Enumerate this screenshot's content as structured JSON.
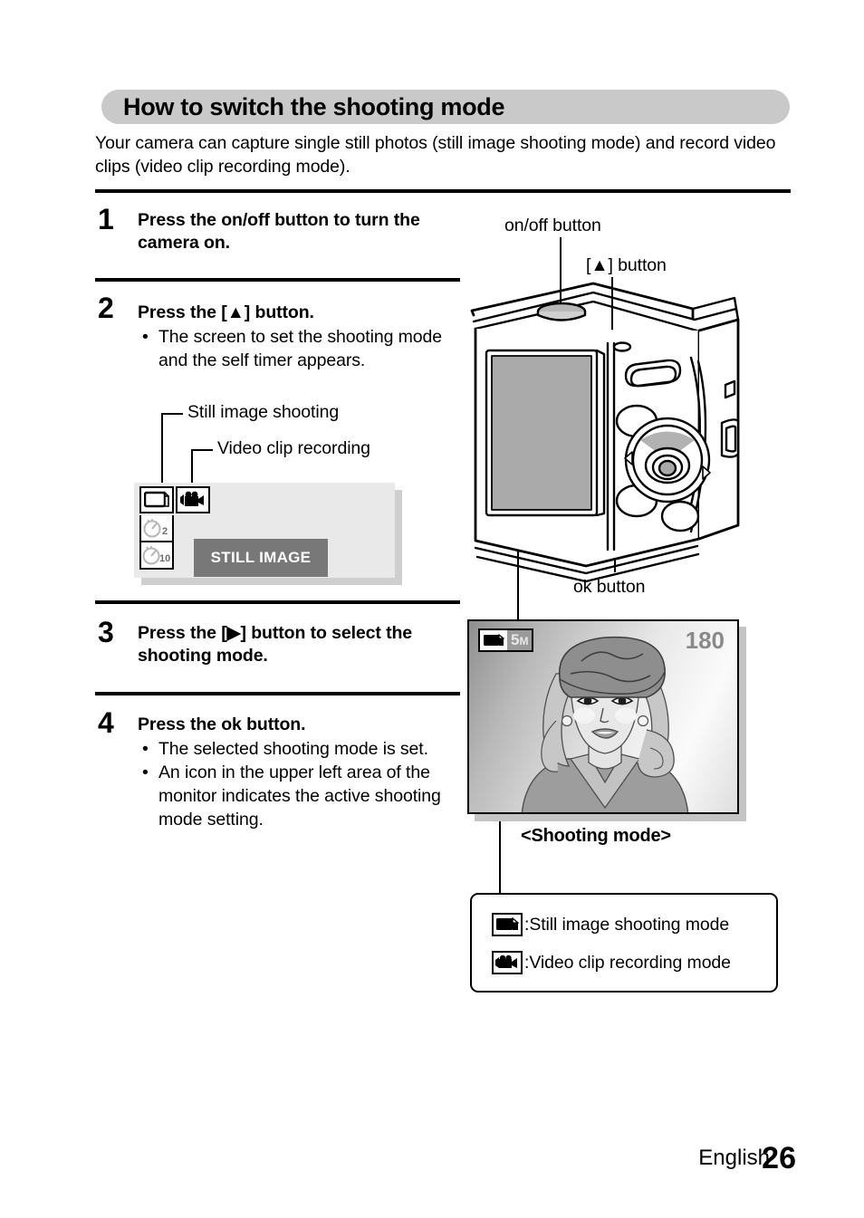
{
  "section": {
    "title": "How to switch the shooting mode",
    "header_bg": "#c9c9c9",
    "intro": "Your camera can capture single still photos (still image shooting mode) and record video clips (video clip recording mode)."
  },
  "steps": [
    {
      "number": "1",
      "title": "Press the on/off button to turn the camera on.",
      "bullets": []
    },
    {
      "number": "2",
      "title": "Press the [▲] button.",
      "bullets": [
        "The screen to set the shooting mode and the self timer appears."
      ]
    },
    {
      "number": "3",
      "title": "Press the [▶] button to select the shooting mode.",
      "bullets": []
    },
    {
      "number": "4",
      "title": "Press the ok button.",
      "bullets": [
        "The selected shooting mode is set.",
        "An icon in the upper left area of the monitor indicates the active shooting mode setting."
      ]
    }
  ],
  "callouts": {
    "still_image_shooting": "Still image shooting",
    "video_clip_recording": "Video clip recording",
    "onoff_button": "on/off button",
    "up_button": "[▲] button",
    "ok_button": "ok button"
  },
  "menu_screen": {
    "selected_mode_label": "STILL IMAGE",
    "selected_button_bg": "#787878",
    "screen_bg": "#e9e9e9",
    "timer_2_label": "2",
    "timer_10_label": "10",
    "icons": [
      "still-image-icon",
      "video-clip-icon",
      "self-timer-2s-icon",
      "self-timer-10s-icon"
    ]
  },
  "monitor": {
    "resolution_badge": "5",
    "resolution_unit": "M",
    "remaining_count": "180",
    "mode_icon": "still-image-icon",
    "caption": "<Shooting mode>"
  },
  "legend": {
    "rows": [
      {
        "icon": "still-image-icon",
        "text": ":Still image shooting mode"
      },
      {
        "icon": "video-clip-icon",
        "text": ":Video clip recording mode"
      }
    ]
  },
  "footer": {
    "language": "English",
    "page_number": "26"
  }
}
